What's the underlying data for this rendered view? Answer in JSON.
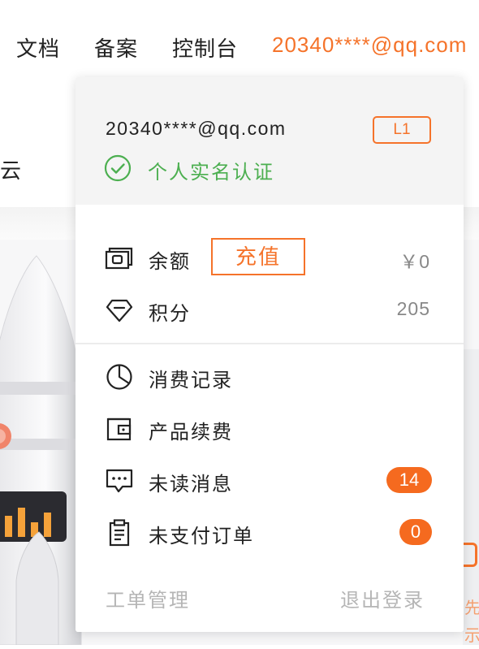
{
  "topnav": {
    "docs": "文档",
    "filing": "备案",
    "console": "控制台",
    "account_email": "20340****@qq.com"
  },
  "background": {
    "partial_text": "云",
    "right_edge_chars": [
      "先",
      "示"
    ]
  },
  "dropdown": {
    "email": "20340****@qq.com",
    "level": "L1",
    "verification": "个人实名认证",
    "balance": {
      "label": "余额",
      "button": "充值",
      "value": "￥0"
    },
    "points": {
      "label": "积分",
      "value": "205"
    },
    "menu": [
      {
        "label": "消费记录",
        "icon": "pie-chart-icon"
      },
      {
        "label": "产品续费",
        "icon": "wallet-icon"
      },
      {
        "label": "未读消息",
        "icon": "message-icon",
        "badge": "14"
      },
      {
        "label": "未支付订单",
        "icon": "clipboard-icon",
        "badge": "0"
      }
    ],
    "footer": {
      "tickets": "工单管理",
      "logout": "退出登录"
    }
  },
  "colors": {
    "accent": "#f5732a",
    "badge": "#f56a1f",
    "verified": "#4caf50",
    "muted": "#b5b5b5"
  }
}
